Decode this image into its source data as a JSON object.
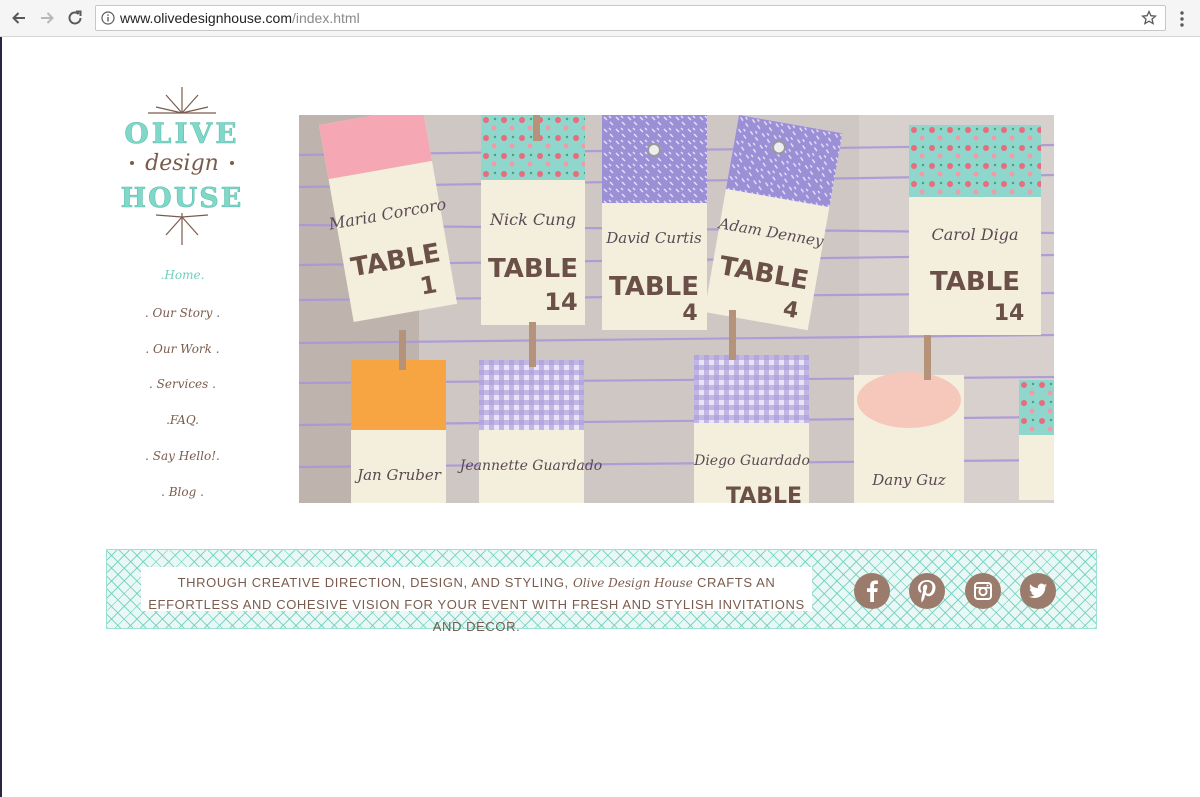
{
  "browser": {
    "url_domain": "www.olivedesignhouse.com",
    "url_path": "/index.html"
  },
  "logo": {
    "line1": "OLIVE",
    "line2": "design",
    "line3": "HOUSE"
  },
  "nav": {
    "items": [
      {
        "label": ".Home."
      },
      {
        "label": ". Our Story ."
      },
      {
        "label": ". Our Work ."
      },
      {
        "label": ". Services ."
      },
      {
        "label": ".FAQ."
      },
      {
        "label": ". Say Hello!."
      },
      {
        "label": ". Blog ."
      }
    ]
  },
  "hero": {
    "tags": [
      {
        "name": "Maria Corcoro",
        "table": "TABLE",
        "num": "1"
      },
      {
        "name": "Nick Cung",
        "table": "TABLE",
        "num": "14"
      },
      {
        "name": "David Curtis",
        "table": "TABLE",
        "num": "4"
      },
      {
        "name": "Adam Denney",
        "table": "TABLE",
        "num": "4"
      },
      {
        "name": "Carol Diga",
        "table": "TABLE",
        "num": "14"
      },
      {
        "name": "Jan Gruber",
        "table": "",
        "num": ""
      },
      {
        "name": "Jeannette Guardado",
        "table": "",
        "num": ""
      },
      {
        "name": "Diego Guardado",
        "table": "TABLE",
        "num": ""
      },
      {
        "name": "Dany Guz",
        "table": "",
        "num": ""
      }
    ]
  },
  "banner": {
    "text_before": "Through creative direction, design, and styling, ",
    "brand": "Olive Design House",
    "text_after": " crafts an effortless and cohesive vision for your event with fresh and stylish invitations and decor."
  },
  "social": [
    "facebook-icon",
    "pinterest-icon",
    "instagram-icon",
    "twitter-icon"
  ],
  "colors": {
    "mint": "#6fcfbf",
    "brown": "#7a5c4e",
    "icon_brown": "#9a7b6c"
  }
}
